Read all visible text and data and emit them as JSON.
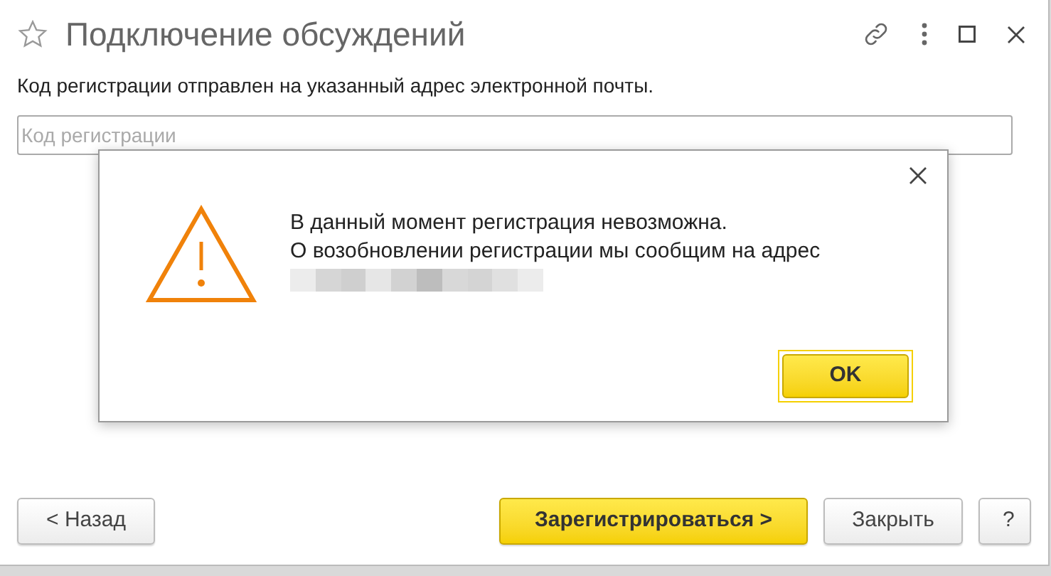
{
  "window": {
    "title": "Подключение обсуждений",
    "favorite": false
  },
  "message": "Код регистрации отправлен на указанный адрес электронной почты.",
  "code_field": {
    "placeholder": "Код регистрации"
  },
  "dialog": {
    "lines": [
      "В данный момент регистрация невозможна.",
      "О возобновлении регистрации мы сообщим на адрес"
    ],
    "ok_button": "OK"
  },
  "buttons": [
    {
      "label": "< Назад",
      "kind": "plain"
    },
    {
      "label": "Зарегистрироваться >",
      "kind": "primary"
    },
    {
      "label": "Закрыть",
      "kind": "plain"
    },
    {
      "label": "?",
      "kind": "plain"
    }
  ]
}
